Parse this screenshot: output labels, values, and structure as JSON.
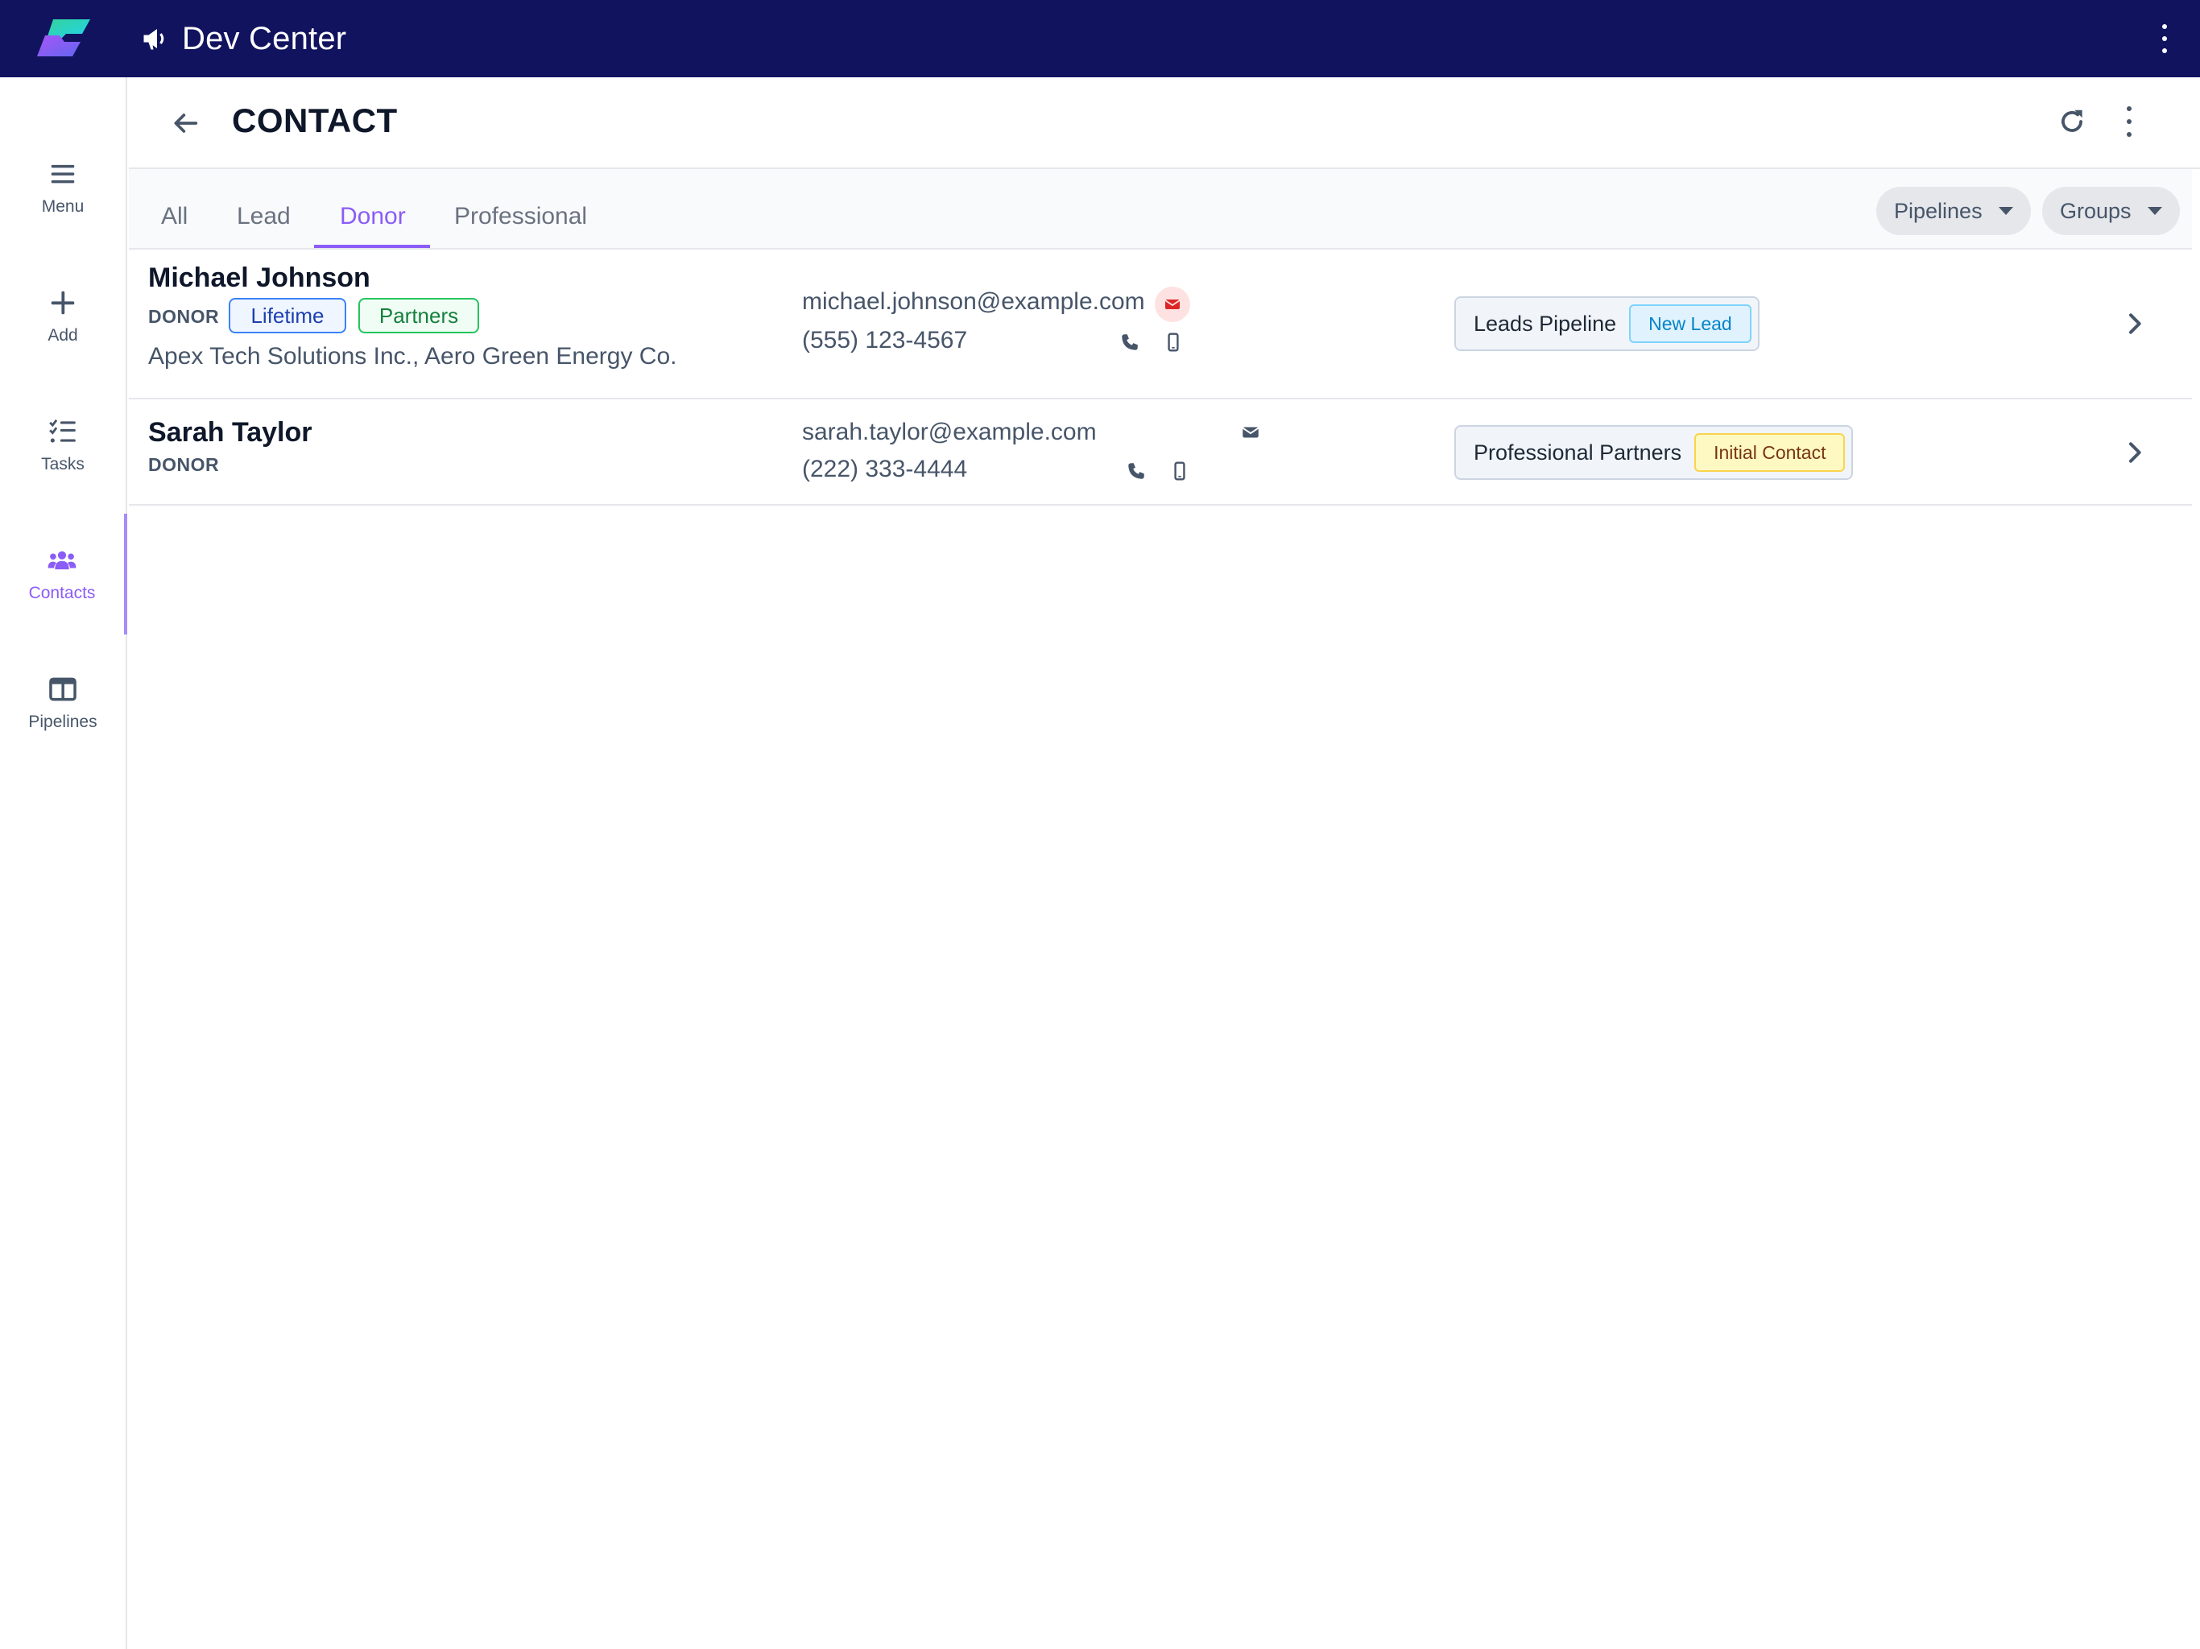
{
  "app": {
    "title": "Dev Center"
  },
  "sidebar": {
    "items": [
      {
        "label": "Menu",
        "icon": "menu-icon"
      },
      {
        "label": "Add",
        "icon": "plus-icon"
      },
      {
        "label": "Tasks",
        "icon": "tasks-icon"
      },
      {
        "label": "Contacts",
        "icon": "users-icon",
        "active": true
      },
      {
        "label": "Pipelines",
        "icon": "columns-icon"
      }
    ]
  },
  "header": {
    "title": "CONTACT"
  },
  "tabs": [
    {
      "label": "All"
    },
    {
      "label": "Lead"
    },
    {
      "label": "Donor",
      "active": true
    },
    {
      "label": "Professional"
    }
  ],
  "filters": {
    "pipelines_label": "Pipelines",
    "groups_label": "Groups"
  },
  "contacts": [
    {
      "name": "Michael Johnson",
      "role": "DONOR",
      "tags": [
        "Lifetime",
        "Partners"
      ],
      "companies": "Apex Tech Solutions Inc., Aero Green Energy Co.",
      "email": "michael.johnson@example.com",
      "phone": "(555) 123-4567",
      "pipeline": "Leads Pipeline",
      "stage": "New Lead"
    },
    {
      "name": "Sarah Taylor",
      "role": "DONOR",
      "tags": [],
      "companies": "",
      "email": "sarah.taylor@example.com",
      "phone": "(222) 333-4444",
      "pipeline": "Professional Partners",
      "stage": "Initial Contact"
    }
  ],
  "colors": {
    "topbar": "#11135f",
    "accent": "#8b5cf6"
  }
}
